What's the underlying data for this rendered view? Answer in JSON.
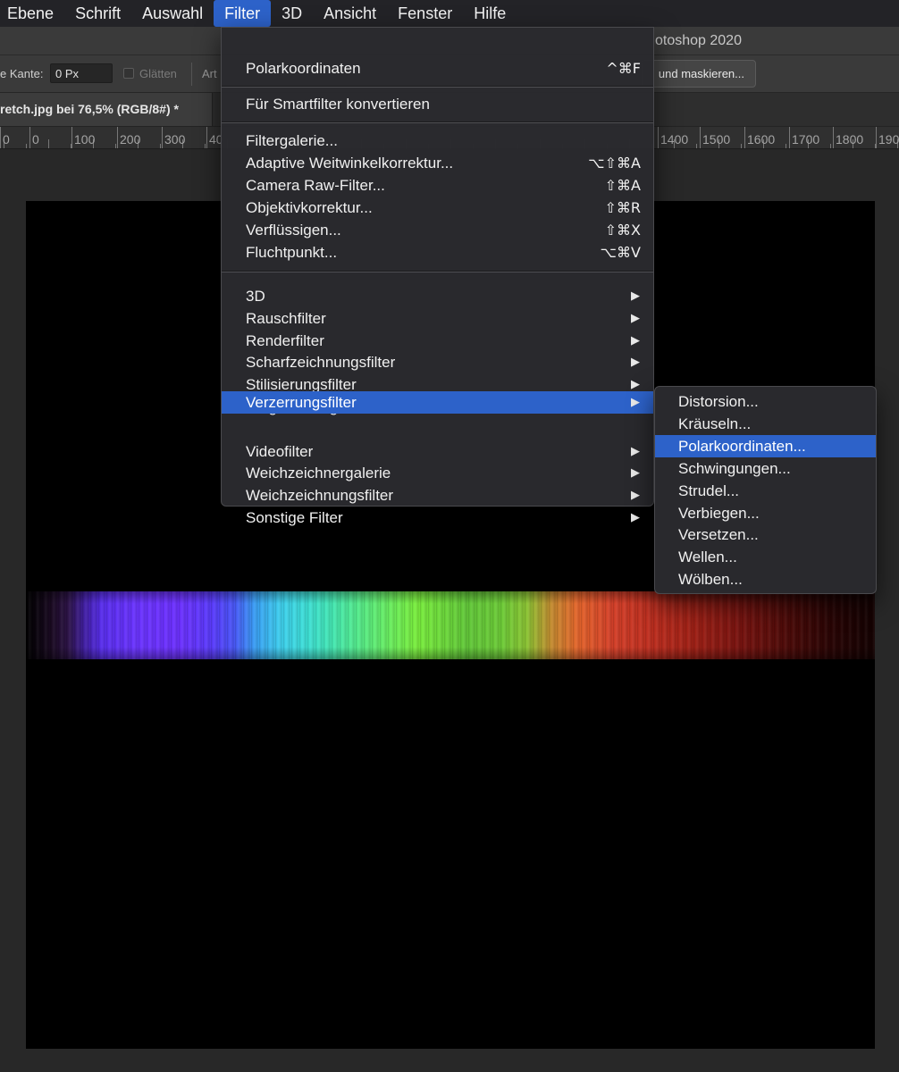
{
  "menubar": {
    "items": [
      "Ebene",
      "Schrift",
      "Auswahl",
      "Filter",
      "3D",
      "Ansicht",
      "Fenster",
      "Hilfe"
    ],
    "active_index": 3
  },
  "window": {
    "app_title": "otoshop 2020"
  },
  "options_bar": {
    "edge_label": "e Kante:",
    "edge_value": "0 Px",
    "smooth_label": "Glätten",
    "art_label": "Art",
    "mask_button": "und maskieren..."
  },
  "document_tab": {
    "label": "retch.jpg bei 76,5% (RGB/8#) *"
  },
  "ruler": {
    "labels": [
      "0",
      "0",
      "100",
      "200",
      "300",
      "40",
      "1400",
      "1500",
      "1600",
      "1700",
      "1800",
      "190"
    ]
  },
  "filter_menu": {
    "last_filter": {
      "label": "Polarkoordinaten",
      "shortcut": "^⌘F"
    },
    "smartfilter": {
      "label": "Für Smartfilter konvertieren"
    },
    "special": [
      {
        "label": "Filtergalerie...",
        "shortcut": ""
      },
      {
        "label": "Adaptive Weitwinkelkorrektur...",
        "shortcut": "⌥⇧⌘A"
      },
      {
        "label": "Camera Raw-Filter...",
        "shortcut": "⇧⌘A"
      },
      {
        "label": "Objektivkorrektur...",
        "shortcut": "⇧⌘R"
      },
      {
        "label": "Verflüssigen...",
        "shortcut": "⇧⌘X"
      },
      {
        "label": "Fluchtpunkt...",
        "shortcut": "⌥⌘V"
      }
    ],
    "submenus": [
      {
        "label": "3D"
      },
      {
        "label": "Rauschfilter"
      },
      {
        "label": "Renderfilter"
      },
      {
        "label": "Scharfzeichnungsfilter"
      },
      {
        "label": "Stilisierungsfilter"
      },
      {
        "label": "Vergröberungsfilter"
      },
      {
        "label": "Verzerrungsfilter"
      },
      {
        "label": "Videofilter"
      },
      {
        "label": "Weichzeichnergalerie"
      },
      {
        "label": "Weichzeichnungsfilter"
      },
      {
        "label": "Sonstige Filter"
      }
    ],
    "highlighted_submenu": "Verzerrungsfilter",
    "submenu_arrow": "▶"
  },
  "distort_submenu": {
    "items": [
      "Distorsion...",
      "Kräuseln...",
      "Polarkoordinaten...",
      "Schwingungen...",
      "Strudel...",
      "Verbiegen...",
      "Versetzen...",
      "Wellen...",
      "Wölben..."
    ],
    "highlighted": "Polarkoordinaten..."
  },
  "colors": {
    "menu_highlight": "#2d62c9",
    "canvas_background": "#000000",
    "workspace_background": "#282828"
  }
}
